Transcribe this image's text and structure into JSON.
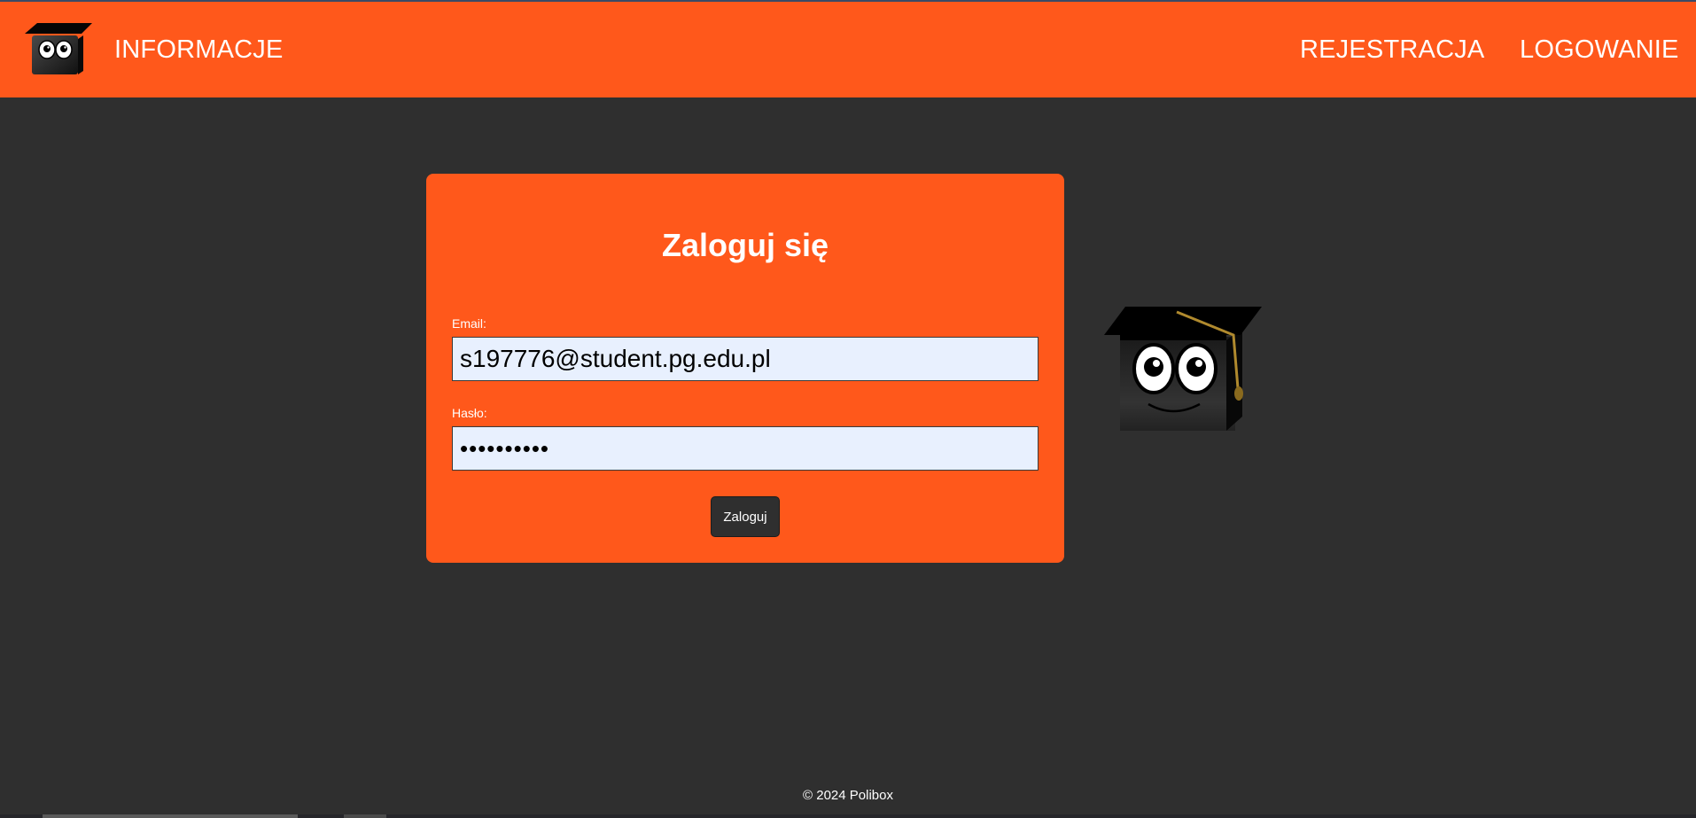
{
  "header": {
    "nav_info": "INFORMACJE",
    "nav_register": "REJESTRACJA",
    "nav_login": "LOGOWANIE"
  },
  "login_form": {
    "title": "Zaloguj się",
    "email_label": "Email:",
    "email_value": "s197776@student.pg.edu.pl",
    "password_label": "Hasło:",
    "password_value": "••••••••••",
    "submit_label": "Zaloguj"
  },
  "footer": {
    "copyright": "© 2024 Polibox"
  },
  "icons": {
    "header_logo": "mascot-logo-icon",
    "side_image": "mascot-graduation-cap-icon"
  },
  "colors": {
    "accent": "#ff581b",
    "background": "#2f2f2f",
    "input_background": "#e8f0fe"
  }
}
